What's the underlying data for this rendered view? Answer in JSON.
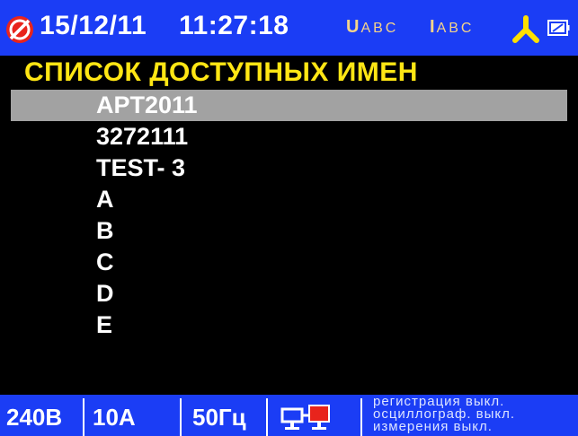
{
  "header": {
    "date": "15/12/11",
    "time": "11:27:18",
    "voltage_indicator": {
      "main": "U",
      "sub": "ABC"
    },
    "current_indicator": {
      "main": "I",
      "sub": "ABC"
    },
    "icons": {
      "logo": "brand-logo-icon",
      "phase": "three-phase-wye-icon",
      "battery": "battery-icon"
    }
  },
  "list": {
    "title": "СПИСОК ДОСТУПНЫХ ИМЕН",
    "selected_index": 0,
    "items": [
      {
        "label": "APT2011"
      },
      {
        "label": "3272111"
      },
      {
        "label": "TEST- 3"
      },
      {
        "label": "A"
      },
      {
        "label": "B"
      },
      {
        "label": "C"
      },
      {
        "label": "D"
      },
      {
        "label": "E"
      }
    ]
  },
  "footer": {
    "voltage": "240В",
    "current": "10A",
    "frequency": "50Гц",
    "connection_icon": "pc-connection-icon",
    "status_lines": [
      "регистрация выкл.",
      "осциллограф. выкл.",
      "измерения выкл."
    ]
  },
  "colors": {
    "bar_background": "#1b3df5",
    "title_text": "#ffe614",
    "indicator_text": "#f5d48a",
    "selection_background": "#a2a2a2",
    "logo_red": "#e8241c",
    "phase_icon": "#ffe000"
  }
}
